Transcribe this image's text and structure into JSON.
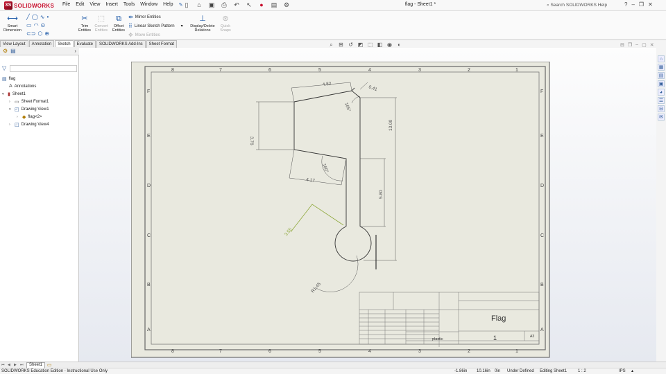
{
  "app": {
    "brand": "SOLIDWORKS",
    "document_title": "flag - Sheet1 *",
    "search_placeholder": "Search SOLIDWORKS Help"
  },
  "menu": [
    "File",
    "Edit",
    "View",
    "Insert",
    "Tools",
    "Window",
    "Help"
  ],
  "ribbon": {
    "smart_dimension": "Smart Dimension",
    "trim_entities": "Trim Entities",
    "convert_entities": "Convert Entities",
    "offset_entities": "Offset Entities",
    "mirror_entities": "Mirror Entities",
    "linear_sketch_pattern": "Linear Sketch Pattern",
    "move_entities": "Move Entities",
    "display_delete_relations": "Display/Delete Relations",
    "quick_snaps": "Quick Snaps"
  },
  "tabs": [
    "View Layout",
    "Annotation",
    "Sketch",
    "Evaluate",
    "SOLIDWORKS Add-Ins",
    "Sheet Format"
  ],
  "active_tab": "Sketch",
  "tree": [
    {
      "label": "flag",
      "icon": "drawing-icon"
    },
    {
      "label": "Annotations",
      "icon": "annotations-icon"
    },
    {
      "label": "Sheet1",
      "icon": "sheet-icon"
    },
    {
      "label": "Sheet Format1",
      "icon": "sheet-format-icon"
    },
    {
      "label": "Drawing View1",
      "icon": "drawing-view-icon"
    },
    {
      "label": "flag<2>",
      "icon": "part-icon"
    },
    {
      "label": "Drawing View4",
      "icon": "drawing-view-icon"
    }
  ],
  "sheet": {
    "zone_numbers": [
      "8",
      "7",
      "6",
      "5",
      "4",
      "3",
      "2",
      "1"
    ],
    "zone_letters": [
      "F",
      "E",
      "D",
      "C",
      "B",
      "A"
    ],
    "dimensions": {
      "top_width": "4.82",
      "small_top": "0.41",
      "angle_top": "165°",
      "left_height": "3.76",
      "right_height": "13.00",
      "mid_width": "4.17",
      "angle_mid": "160°",
      "lower_height": "5.80",
      "green_length": "3.55",
      "radius": "R1.45"
    },
    "title_block": {
      "title": "Flag",
      "material": "plastic",
      "sheet_number": "1",
      "size": "A3"
    }
  },
  "bottom": {
    "sheet_tab": "Sheet1"
  },
  "status": {
    "edition": "SOLIDWORKS Education Edition - Instructional Use Only",
    "x": "-1.86in",
    "y": "10.16in",
    "z": "0in",
    "state": "Under Defined",
    "editing": "Editing Sheet1",
    "scale": "1 : 2",
    "units": "IPS"
  }
}
